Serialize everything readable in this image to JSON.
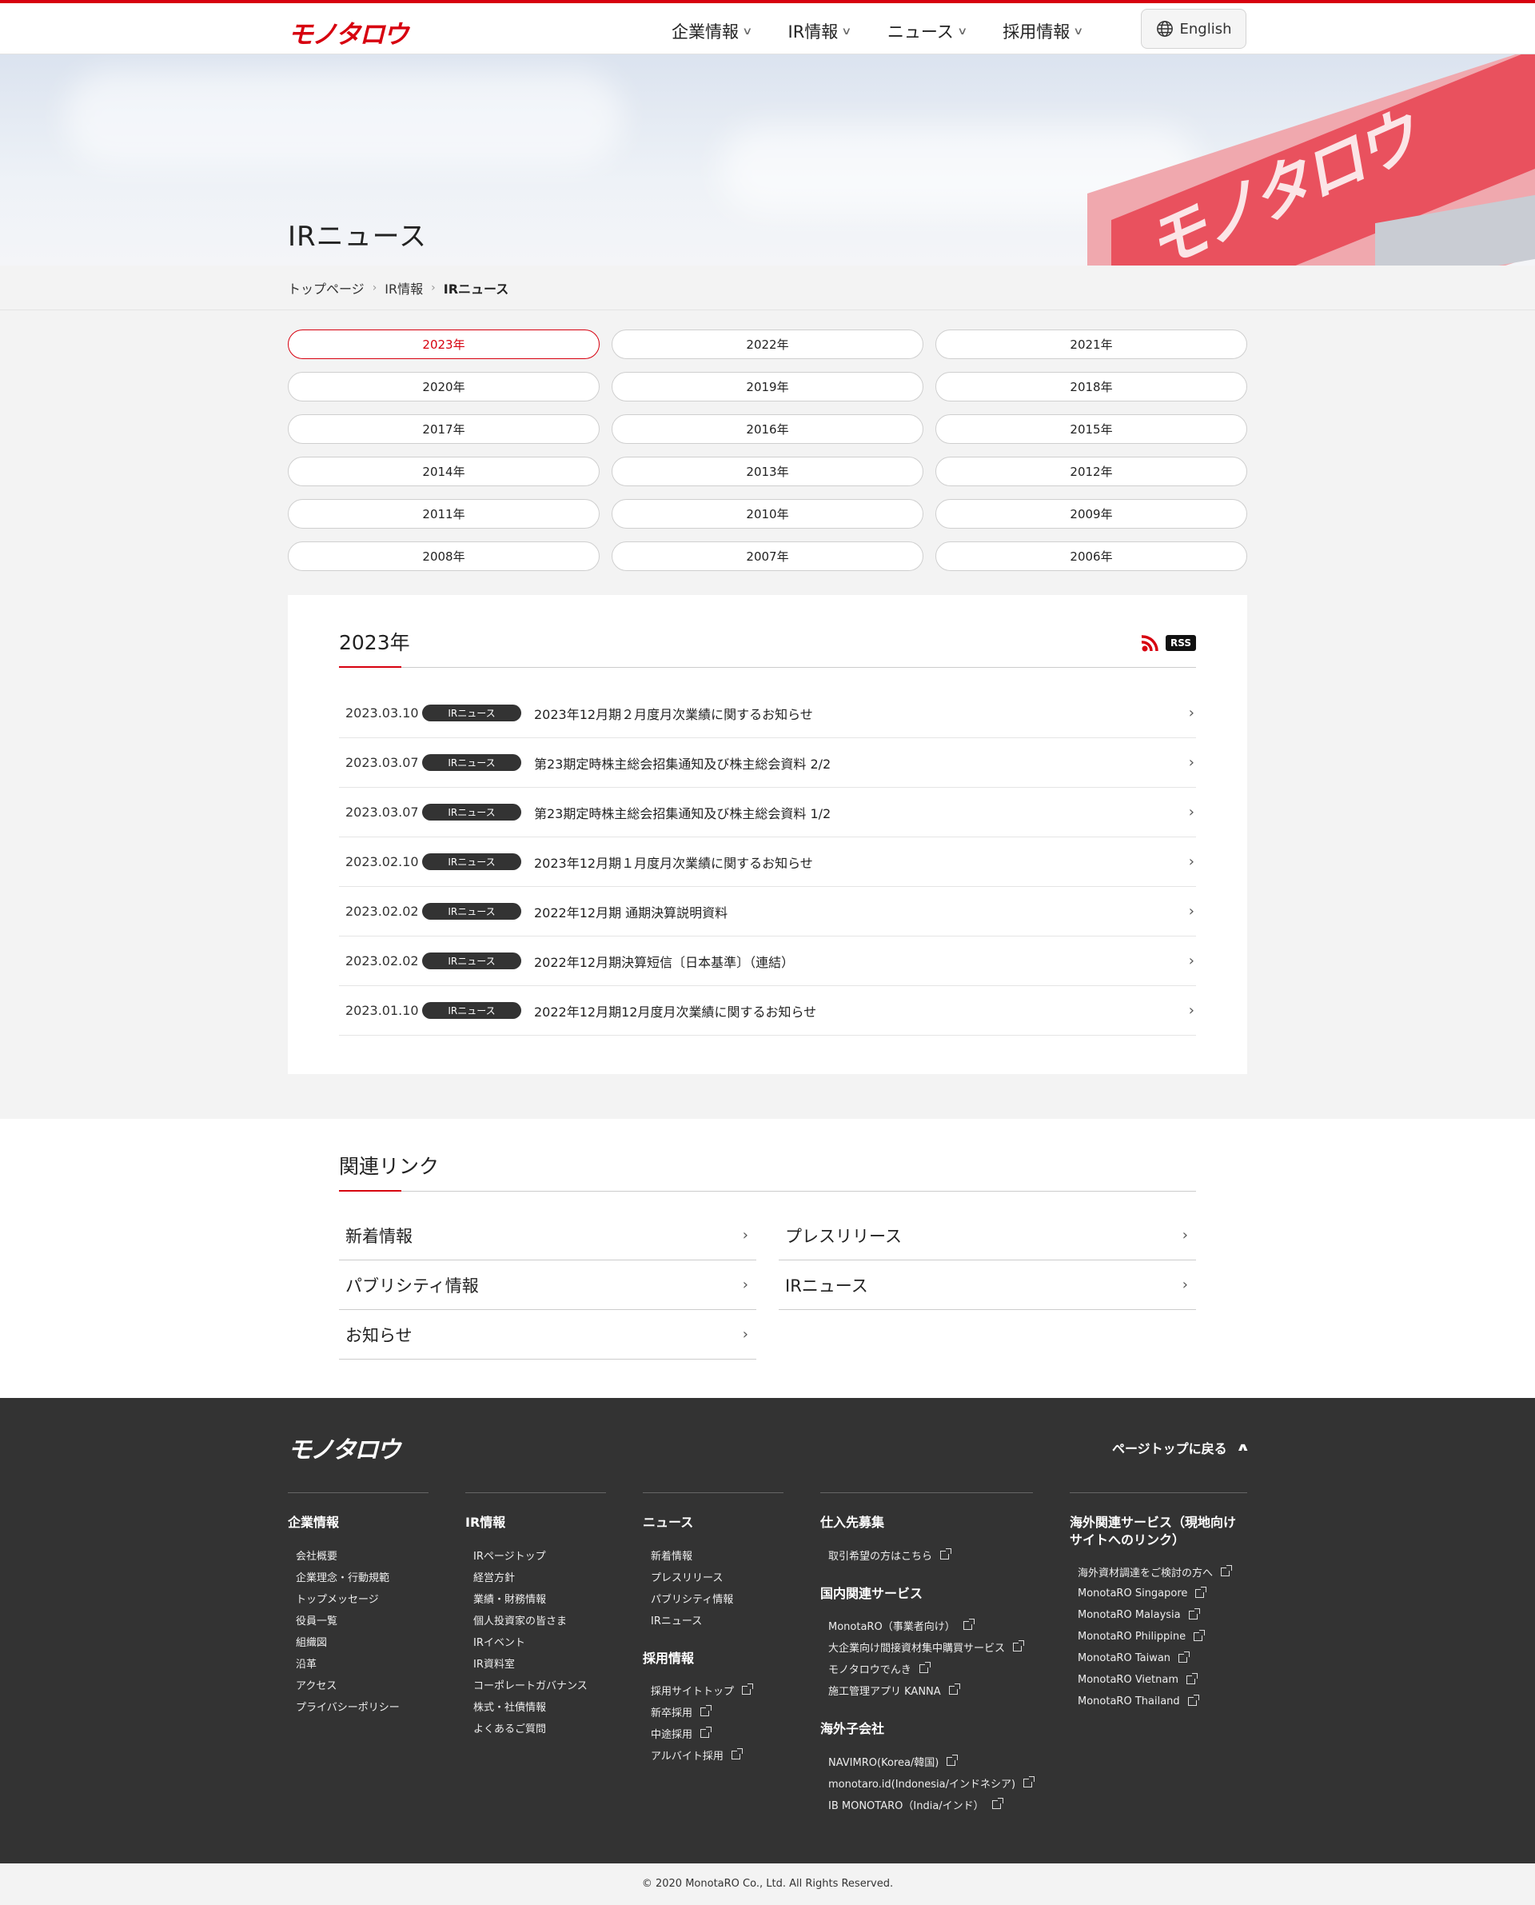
{
  "brand": {
    "logo_text": "モノタロウ",
    "accent": "#d7000f"
  },
  "header": {
    "nav": [
      {
        "label": "企業情報"
      },
      {
        "label": "IR情報"
      },
      {
        "label": "ニュース"
      },
      {
        "label": "採用情報"
      }
    ],
    "lang_label": "English"
  },
  "hero": {
    "title": "IRニュース",
    "sign_text": "モノタロウ"
  },
  "breadcrumb": [
    "トップページ",
    "IR情報",
    "IRニュース"
  ],
  "years": [
    "2023年",
    "2022年",
    "2021年",
    "2020年",
    "2019年",
    "2018年",
    "2017年",
    "2016年",
    "2015年",
    "2014年",
    "2013年",
    "2012年",
    "2011年",
    "2010年",
    "2009年",
    "2008年",
    "2007年",
    "2006年"
  ],
  "selected_year": "2023年",
  "panel": {
    "title": "2023年",
    "rss_label": "RSS",
    "news": [
      {
        "date": "2023.03.10",
        "tag": "IRニュース",
        "title": "2023年12月期２月度月次業績に関するお知らせ"
      },
      {
        "date": "2023.03.07",
        "tag": "IRニュース",
        "title": "第23期定時株主総会招集通知及び株主総会資料 2/2"
      },
      {
        "date": "2023.03.07",
        "tag": "IRニュース",
        "title": "第23期定時株主総会招集通知及び株主総会資料 1/2"
      },
      {
        "date": "2023.02.10",
        "tag": "IRニュース",
        "title": "2023年12月期１月度月次業績に関するお知らせ"
      },
      {
        "date": "2023.02.02",
        "tag": "IRニュース",
        "title": "2022年12月期 通期決算説明資料"
      },
      {
        "date": "2023.02.02",
        "tag": "IRニュース",
        "title": "2022年12月期決算短信〔日本基準〕（連結）"
      },
      {
        "date": "2023.01.10",
        "tag": "IRニュース",
        "title": "2022年12月期12月度月次業績に関するお知らせ"
      }
    ]
  },
  "related": {
    "title": "関連リンク",
    "links": [
      "新着情報",
      "プレスリリース",
      "パブリシティ情報",
      "IRニュース",
      "お知らせ"
    ]
  },
  "footer": {
    "logo_text": "モノタロウ",
    "page_top": "ページトップに戻る",
    "col1": {
      "heading": "企業情報",
      "items": [
        "会社概要",
        "企業理念・行動規範",
        "トップメッセージ",
        "役員一覧",
        "組織図",
        "沿革",
        "アクセス",
        "プライバシーポリシー"
      ]
    },
    "col2": {
      "heading": "IR情報",
      "items": [
        "IRページトップ",
        "経営方針",
        "業績・財務情報",
        "個人投資家の皆さま",
        "IRイベント",
        "IR資料室",
        "コーポレートガバナンス",
        "株式・社債情報",
        "よくあるご質問"
      ]
    },
    "col3": {
      "heading": "ニュース",
      "items": [
        "新着情報",
        "プレスリリース",
        "パブリシティ情報",
        "IRニュース"
      ],
      "heading2": "採用情報",
      "items2": [
        "採用サイトトップ",
        "新卒採用",
        "中途採用",
        "アルバイト採用"
      ]
    },
    "col4": {
      "heading": "仕入先募集",
      "items": [
        "取引希望の方はこちら"
      ],
      "heading2": "国内関連サービス",
      "items2": [
        "MonotaRO（事業者向け）",
        "大企業向け間接資材集中購買サービス",
        "モノタロウでんき",
        "施工管理アプリ KANNA"
      ],
      "heading3": "海外子会社",
      "items3": [
        "NAVIMRO(Korea/韓国)",
        "monotaro.id(Indonesia/インドネシア)",
        "IB MONOTARO（India/インド）"
      ]
    },
    "col5": {
      "heading": "海外関連サービス（現地向けサイトへのリンク）",
      "items": [
        "海外資材調達をご検討の方へ",
        "MonotaRO Singapore",
        "MonotaRO Malaysia",
        "MonotaRO Philippine",
        "MonotaRO Taiwan",
        "MonotaRO Vietnam",
        "MonotaRO Thailand"
      ]
    },
    "copyright": "© 2020 MonotaRO Co., Ltd. All Rights Reserved."
  }
}
